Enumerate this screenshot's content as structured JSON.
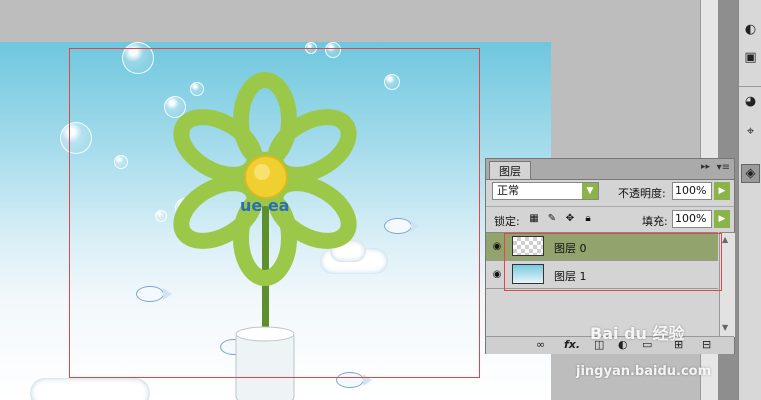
{
  "layers_panel": {
    "tab_label": "图层",
    "blend_mode": "正常",
    "opacity_label": "不透明度:",
    "opacity_value": "100%",
    "lock_label": "锁定:",
    "fill_label": "填充:",
    "fill_value": "100%",
    "layers": [
      {
        "name": "图层 0",
        "selected": true,
        "thumbnail": "checkerboard-flower"
      },
      {
        "name": "图层 1",
        "selected": false,
        "thumbnail": "sky-background"
      }
    ],
    "footer_icons": [
      "link-icon",
      "fx-icon",
      "mask-icon",
      "adjustment-icon",
      "folder-icon",
      "new-layer-icon",
      "trash-icon"
    ]
  },
  "canvas": {
    "artwork_text": "ue ea",
    "sky_color": "#6fc7de",
    "flower_color": "#9cc84a",
    "center_color": "#f0d030"
  },
  "watermark": {
    "logo": "Bai du 经验",
    "url": "jingyan.baidu.com"
  },
  "colors": {
    "selected_layer": "#93a36e",
    "selection_rect": "#e04848",
    "arrow_button": "#8ab44a"
  }
}
